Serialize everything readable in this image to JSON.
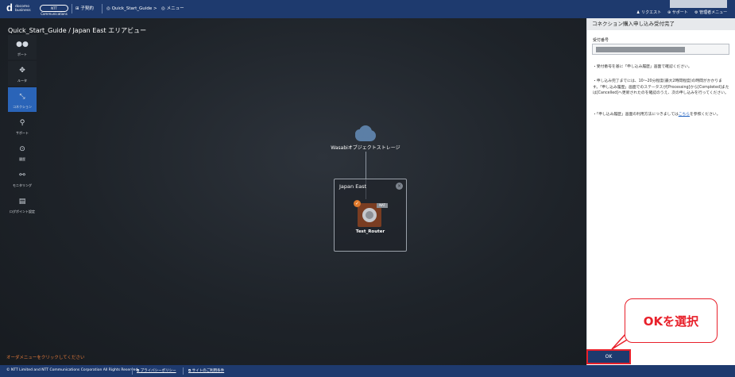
{
  "header": {
    "logo_main": "d",
    "logo_sub": "docomo\nbusiness",
    "ntt_badge": "NTT Communications",
    "contract_label": "子契約",
    "breadcrumb_project": "Quick_Start_Guide",
    "breadcrumb_sep": ">",
    "breadcrumb_menu": "メニュー",
    "request_label": "リクエスト",
    "support_label": "サポート",
    "admin_label": "管理者メニュー"
  },
  "page_title": "Quick_Start_Guide / Japan East エリアビュー",
  "sidebar": {
    "items": [
      {
        "label": "ポート",
        "icon": "port-icon",
        "glyph": "●●",
        "active": false
      },
      {
        "label": "ルータ",
        "icon": "router-icon",
        "glyph": "✥",
        "active": false
      },
      {
        "label": "コネクション",
        "icon": "connection-icon",
        "glyph": "⤡",
        "active": true
      },
      {
        "label": "サポート",
        "icon": "support-icon",
        "glyph": "⚲",
        "active": false
      },
      {
        "label": "履歴",
        "icon": "history-icon",
        "glyph": "⊙",
        "active": false
      },
      {
        "label": "モニタリング",
        "icon": "monitoring-icon",
        "glyph": "⚯",
        "active": false
      },
      {
        "label": "ログポイント設定",
        "icon": "logpoint-icon",
        "glyph": "▤",
        "active": false
      }
    ]
  },
  "diagram": {
    "storage_label": "Wasabiオブジェクトストレージ",
    "area_title": "Japan East",
    "close_glyph": "×",
    "router_label": "Test_Router",
    "nat_badge": "NAT",
    "check_glyph": "✓"
  },
  "footer_hint": "オーダメニューをクリックしてください",
  "bottombar": {
    "copyright": "© NTT Limited and NTT Communications Corporation All Rights Reserved.",
    "privacy": "プライバシーポリシー",
    "terms": "サイトのご利用条件"
  },
  "panel": {
    "title": "コネクション購入申し込み受付完了",
    "receipt_label": "受付番号",
    "note1": "・受付番号を基に「申し込み履歴」画面で確認ください。",
    "note2": "・申し込み完了までには、10〜20分程度(最大2時間程度)の時間がかかります。「申し込み履歴」画面でのステータスが[Processing]から[Completed]または[Cancelled]へ更新されたのを確認のうえ、次の申し込みを行ってください。",
    "note3_pre": "・「申し込み履歴」画面の利用方法につきましては",
    "note3_link": "こちら",
    "note3_post": "を参照ください。",
    "ok_button": "OK"
  },
  "callout_text": "OKを選択",
  "colors": {
    "header_bg": "#1e3a6e",
    "active_nav": "#2a64b8",
    "callout_red": "#e8202a",
    "hint_orange": "#e37a3a"
  }
}
